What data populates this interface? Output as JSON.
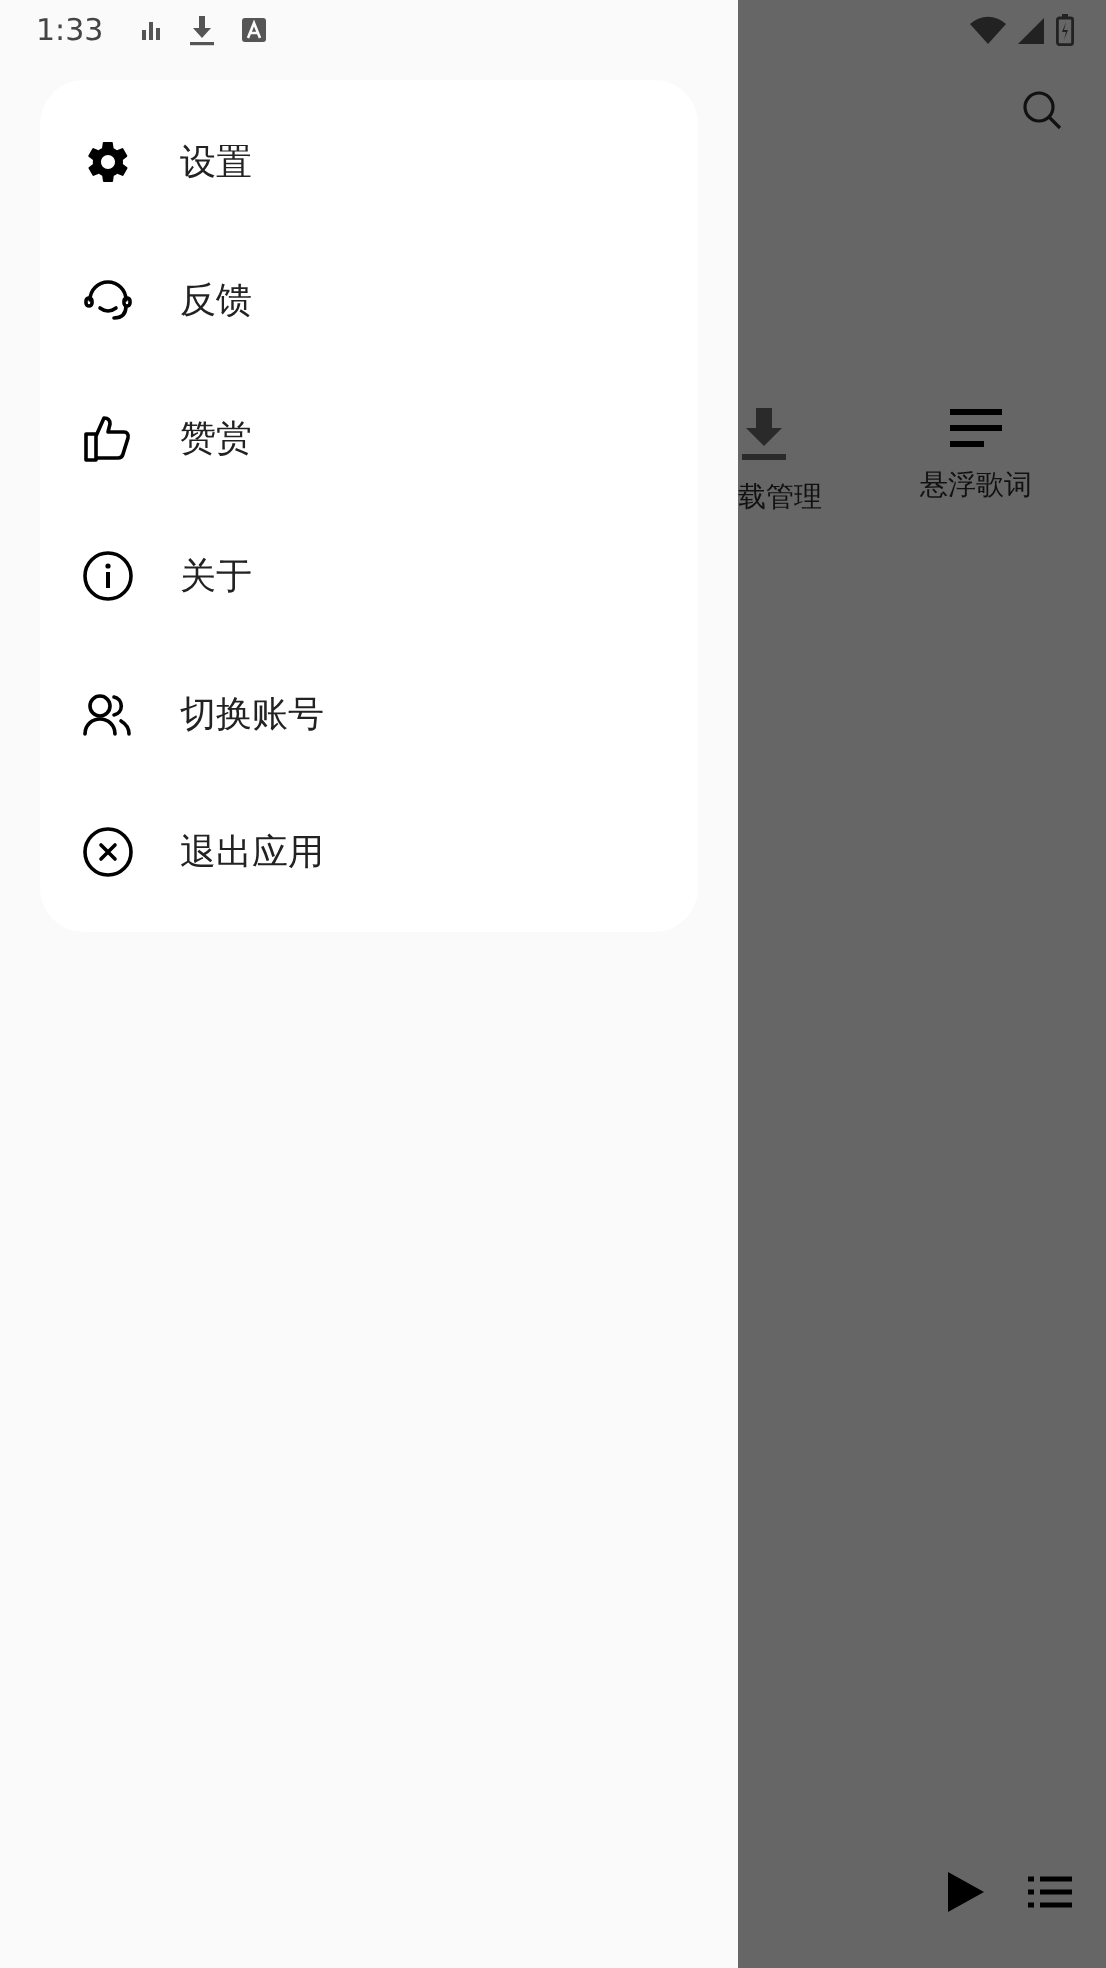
{
  "status_bar": {
    "time": "1:33"
  },
  "menu": {
    "items": [
      {
        "kind": "settings",
        "label": "设置"
      },
      {
        "kind": "feedback",
        "label": "反馈"
      },
      {
        "kind": "like",
        "label": "赞赏"
      },
      {
        "kind": "about",
        "label": "关于"
      },
      {
        "kind": "account",
        "label": "切换账号"
      },
      {
        "kind": "exit",
        "label": "退出应用"
      }
    ]
  },
  "background": {
    "shortcuts": [
      {
        "kind": "download",
        "label": "载管理"
      },
      {
        "kind": "lyrics",
        "label": "悬浮歌词"
      }
    ]
  }
}
